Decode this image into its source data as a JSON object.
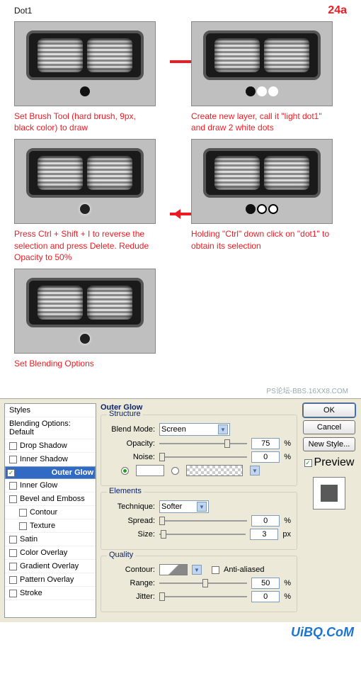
{
  "header": {
    "title": "Dot1",
    "step": "24a"
  },
  "captions": {
    "c1": "Set Brush Tool (hard brush, 9px, black color) to draw",
    "c2": "Create new layer, call it \"light dot1\" and draw 2 white dots",
    "c3": "Press Ctrl + Shift + I to reverse the selection and press Delete. Redude Opacity to 50%",
    "c4": "Holding \"Ctrl\" down click on \"dot1\" to obtain its selection",
    "c5": "Set Blending Options"
  },
  "watermark": "PS论坛-BBS.16XX8.COM",
  "styles": {
    "header": "Styles",
    "items": [
      "Blending Options: Default",
      "Drop Shadow",
      "Inner Shadow",
      "Outer Glow",
      "Inner Glow",
      "Bevel and Emboss",
      "Contour",
      "Texture",
      "Satin",
      "Color Overlay",
      "Gradient Overlay",
      "Pattern Overlay",
      "Stroke"
    ],
    "selected": "Outer Glow"
  },
  "outerglow": {
    "title": "Outer Glow",
    "structure": {
      "legend": "Structure",
      "blendmode_lbl": "Blend Mode:",
      "blendmode": "Screen",
      "opacity_lbl": "Opacity:",
      "opacity": "75",
      "pct": "%",
      "noise_lbl": "Noise:",
      "noise": "0"
    },
    "elements": {
      "legend": "Elements",
      "technique_lbl": "Technique:",
      "technique": "Softer",
      "spread_lbl": "Spread:",
      "spread": "0",
      "size_lbl": "Size:",
      "size": "3",
      "px": "px"
    },
    "quality": {
      "legend": "Quality",
      "contour_lbl": "Contour:",
      "aa": "Anti-aliased",
      "range_lbl": "Range:",
      "range": "50",
      "jitter_lbl": "Jitter:",
      "jitter": "0"
    }
  },
  "buttons": {
    "ok": "OK",
    "cancel": "Cancel",
    "newstyle": "New Style...",
    "preview": "Preview"
  },
  "footer": "UiBQ.CoM"
}
